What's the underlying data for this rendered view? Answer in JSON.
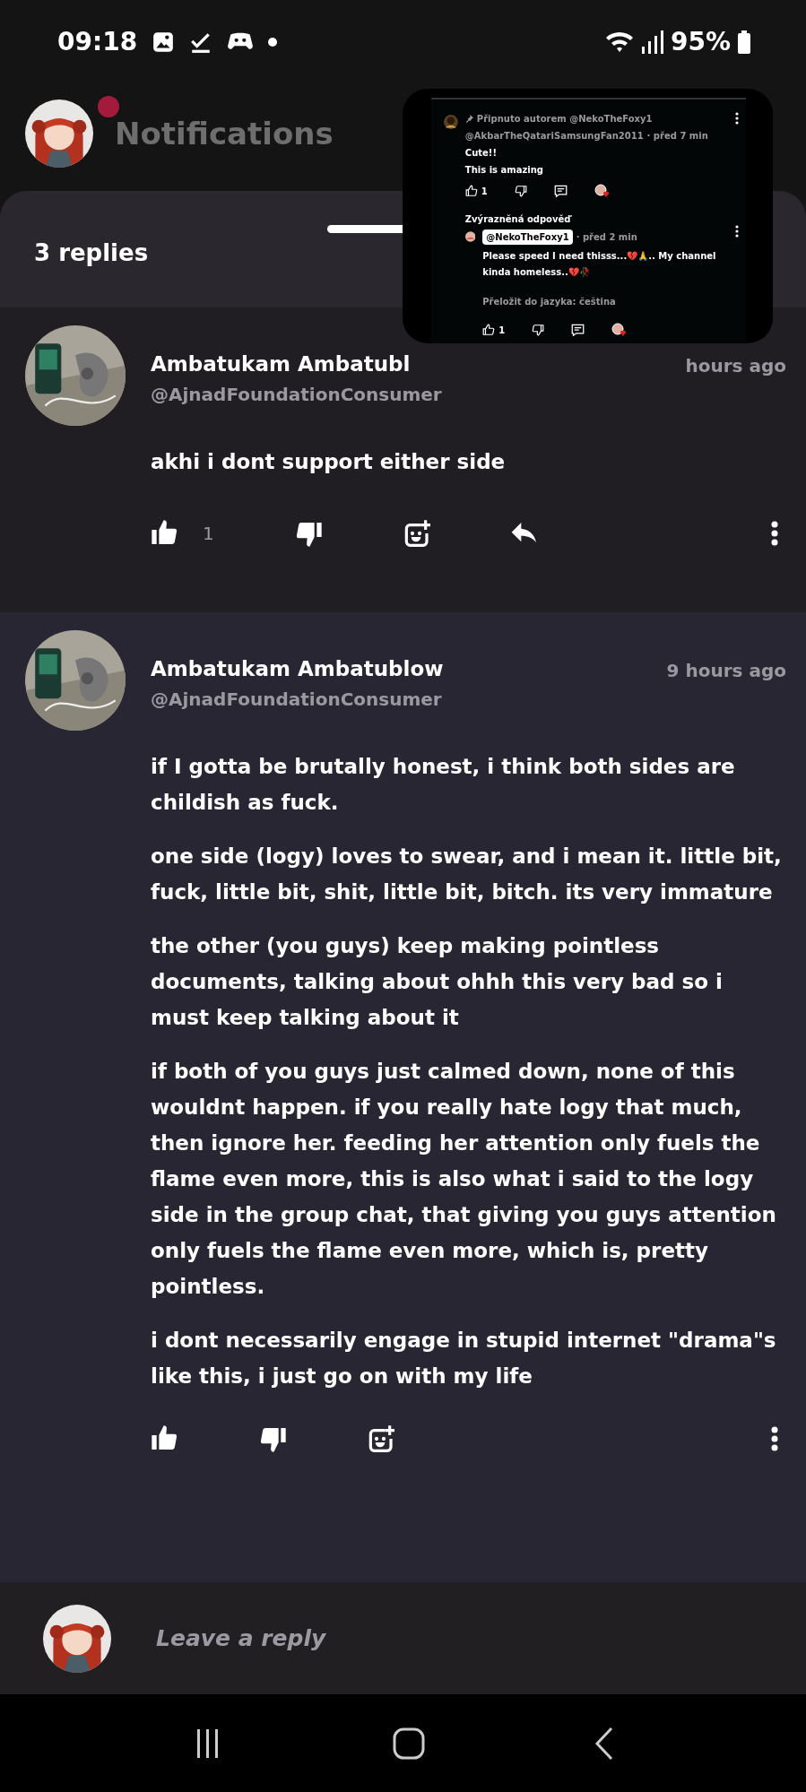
{
  "status_bar": {
    "time": "09:18",
    "battery": "95%"
  },
  "header": {
    "title": "Notifications"
  },
  "sheet": {
    "title": "3 replies"
  },
  "comments": [
    {
      "name": "Ambatukam Ambatubl",
      "handle": "@AjnadFoundationConsumer",
      "time": "hours ago",
      "body": [
        "akhi i dont support either side"
      ],
      "actions": [
        {
          "kind": "like",
          "count": "1"
        },
        {
          "kind": "dislike"
        },
        {
          "kind": "react"
        },
        {
          "kind": "reply"
        }
      ]
    },
    {
      "name": "Ambatukam Ambatublow",
      "handle": "@AjnadFoundationConsumer",
      "time": "9 hours ago",
      "body": [
        "if I gotta be brutally honest, i think both sides are childish as fuck.",
        "one side (logy) loves to swear, and i mean it. little bit, fuck, little bit, shit, little bit, bitch. its very immature",
        "the other (you guys) keep making pointless documents, talking about ohhh this very bad so i must keep talking about it",
        "if both of you guys just calmed down, none of this wouldnt happen. if you really hate logy that much, then ignore her. feeding her attention only fuels the flame even more, this is also what i said to the logy side in the group chat, that giving you guys attention only fuels the flame even more, which is, pretty pointless.",
        "i dont necessarily engage in stupid internet \"drama\"s like this, i just go on with my life"
      ],
      "actions": [
        {
          "kind": "like"
        },
        {
          "kind": "dislike"
        },
        {
          "kind": "react"
        }
      ]
    }
  ],
  "reply_bar": {
    "placeholder": "Leave a reply"
  },
  "pip": {
    "pinned_label": "Připnuto autorem @NekoTheFoxy1",
    "author": "@AkbarTheQatariSamsungFan2011",
    "time": "· před 7 min",
    "lines": [
      "Cute!!",
      "This is amazing"
    ],
    "like_count": "1",
    "highlight_label": "Zvýrazněná odpověď",
    "reply_author": "@NekoTheFoxy1",
    "reply_time": "· před 2 min",
    "reply_text": "Please speed I need thisss...💔🙏.. My channel kinda homeless..💔🥀",
    "translate": "Přeložit do jazyka: čeština",
    "reply_like_count": "1"
  }
}
